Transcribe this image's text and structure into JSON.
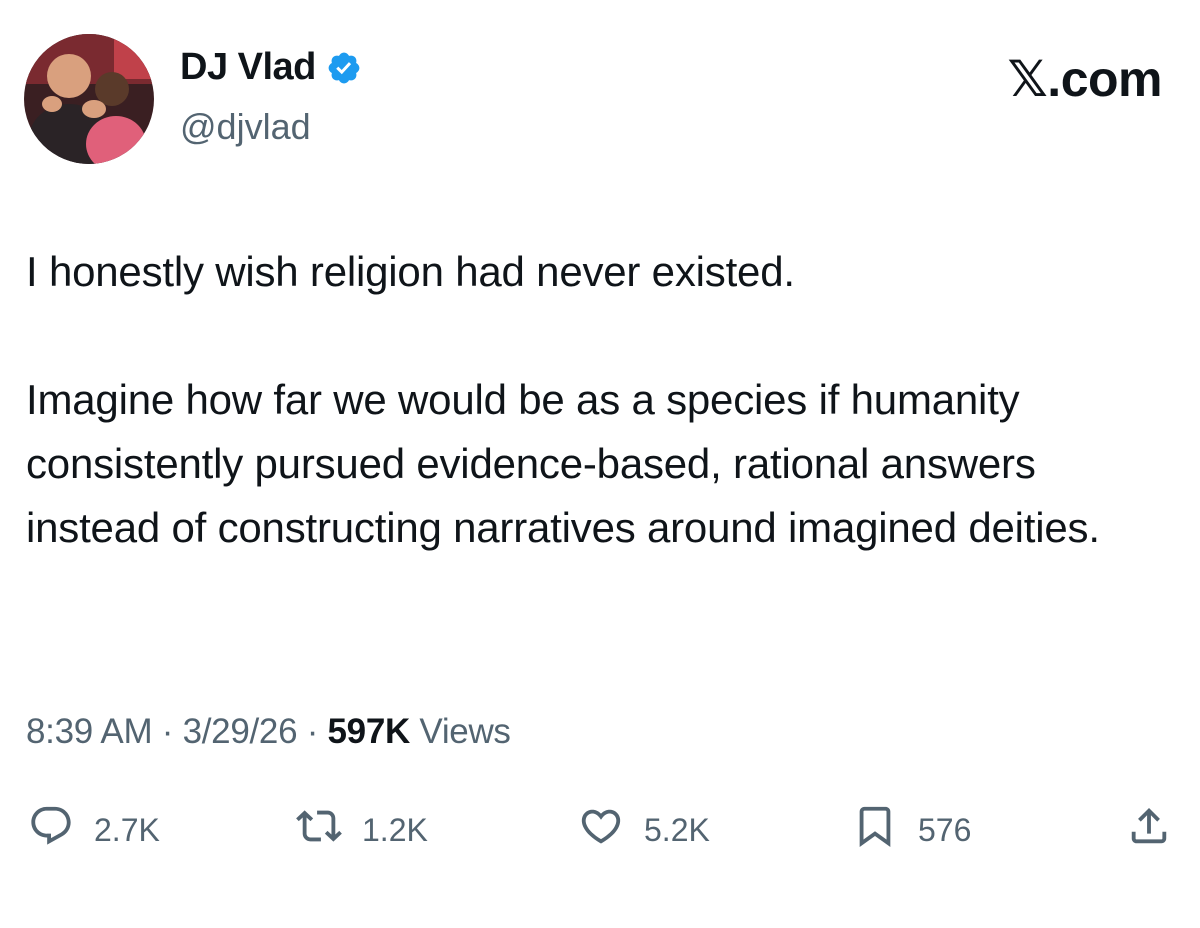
{
  "author": {
    "display_name": "DJ Vlad",
    "handle": "@djvlad",
    "verified_icon": "verified-badge-icon",
    "verified_color": "#1d9bf0"
  },
  "brand": {
    "label": "𝕏.com"
  },
  "tweet": {
    "paragraphs": [
      "I honestly wish religion had never existed.",
      "Imagine how far we would be as a species if humanity consistently pursued evidence-based, rational answers instead of constructing narratives around imagined deities."
    ],
    "time": "8:39 AM",
    "date": "3/29/26",
    "separator": "·",
    "views_count": "597K",
    "views_label": "Views"
  },
  "actions": {
    "reply": {
      "icon": "reply-icon",
      "count": "2.7K"
    },
    "repost": {
      "icon": "repost-icon",
      "count": "1.2K"
    },
    "like": {
      "icon": "heart-icon",
      "count": "5.2K"
    },
    "bookmark": {
      "icon": "bookmark-icon",
      "count": "576"
    },
    "share": {
      "icon": "share-icon"
    }
  },
  "colors": {
    "text": "#0f1419",
    "secondary": "#536471",
    "background": "#ffffff"
  }
}
